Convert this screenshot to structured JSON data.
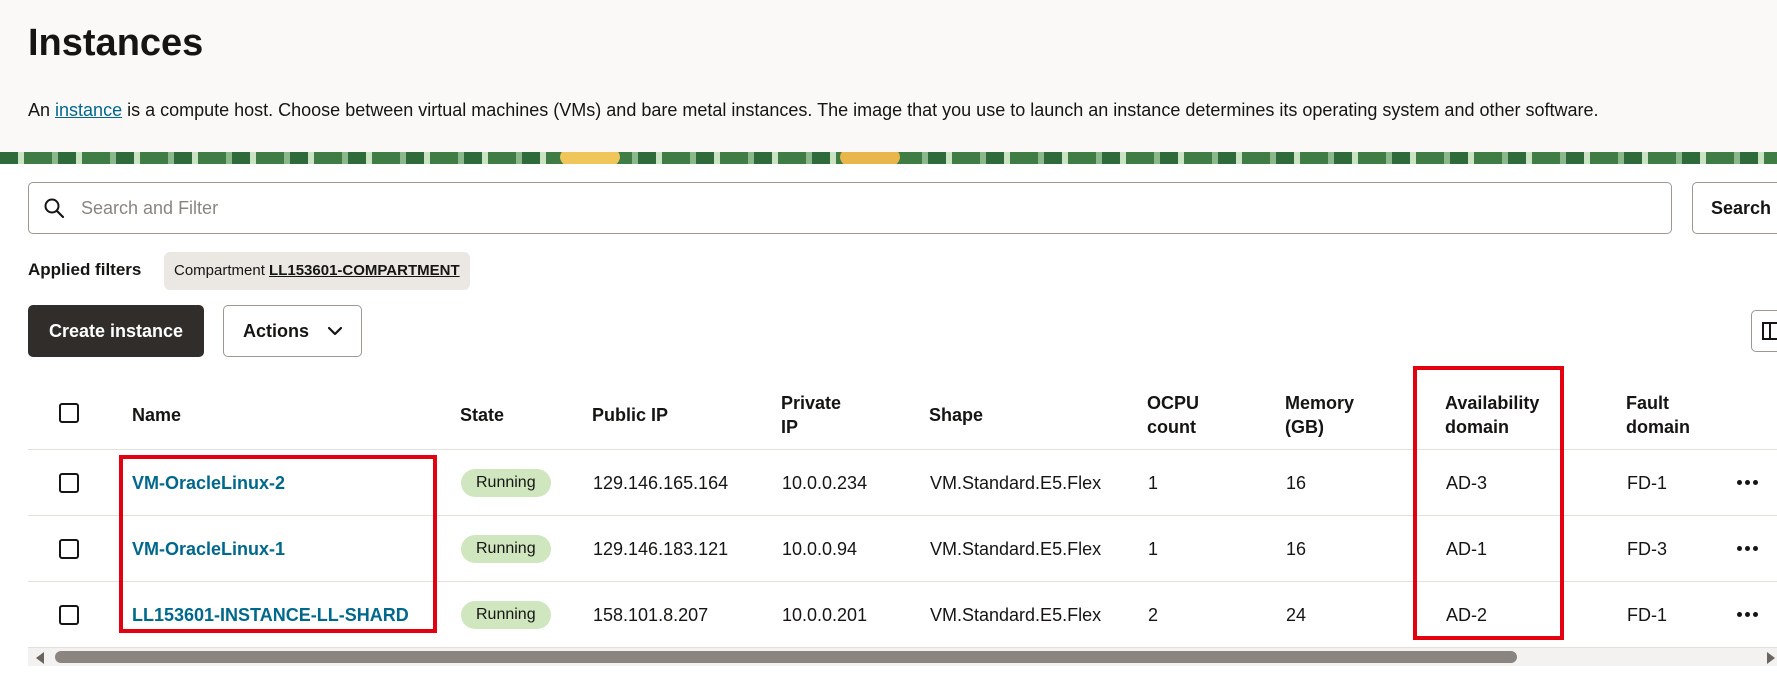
{
  "header": {
    "title": "Instances",
    "description_prefix": "An ",
    "description_link": "instance",
    "description_suffix": " is a compute host. Choose between virtual machines (VMs) and bare metal instances. The image that you use to launch an instance determines its operating system and other software."
  },
  "search": {
    "placeholder": "Search and Filter",
    "value": "",
    "button_label": "Search"
  },
  "filters": {
    "label": "Applied filters",
    "chip_key": "Compartment",
    "chip_value": "LL153601-COMPARTMENT"
  },
  "toolbar": {
    "create_label": "Create instance",
    "actions_label": "Actions"
  },
  "table": {
    "headers": {
      "name": "Name",
      "state": "State",
      "public_ip": "Public IP",
      "private_ip_1": "Private",
      "private_ip_2": "IP",
      "shape": "Shape",
      "ocpu_1": "OCPU",
      "ocpu_2": "count",
      "memory_1": "Memory",
      "memory_2": "(GB)",
      "ad_1": "Availability",
      "ad_2": "domain",
      "fd_1": "Fault",
      "fd_2": "domain"
    },
    "rows": [
      {
        "name": "VM-OracleLinux-2",
        "state": "Running",
        "public_ip": "129.146.165.164",
        "private_ip": "10.0.0.234",
        "shape": "VM.Standard.E5.Flex",
        "ocpu": "1",
        "memory": "16",
        "ad": "AD-3",
        "fd": "FD-1"
      },
      {
        "name": "VM-OracleLinux-1",
        "state": "Running",
        "public_ip": "129.146.183.121",
        "private_ip": "10.0.0.94",
        "shape": "VM.Standard.E5.Flex",
        "ocpu": "1",
        "memory": "16",
        "ad": "AD-1",
        "fd": "FD-3"
      },
      {
        "name": "LL153601-INSTANCE-LL-SHARD",
        "state": "Running",
        "public_ip": "158.101.8.207",
        "private_ip": "10.0.0.201",
        "shape": "VM.Standard.E5.Flex",
        "ocpu": "2",
        "memory": "24",
        "ad": "AD-2",
        "fd": "FD-1"
      }
    ]
  },
  "colors": {
    "link": "#00688c",
    "primary_button": "#312d2a",
    "running_badge": "#cfe6bf",
    "highlight": "#e3000f",
    "header_bg": "#fbf9f8"
  },
  "icons": [
    "search-icon",
    "chevron-down-icon",
    "column-view-icon",
    "more-actions-icon",
    "scroll-left-arrow",
    "scroll-right-arrow"
  ]
}
